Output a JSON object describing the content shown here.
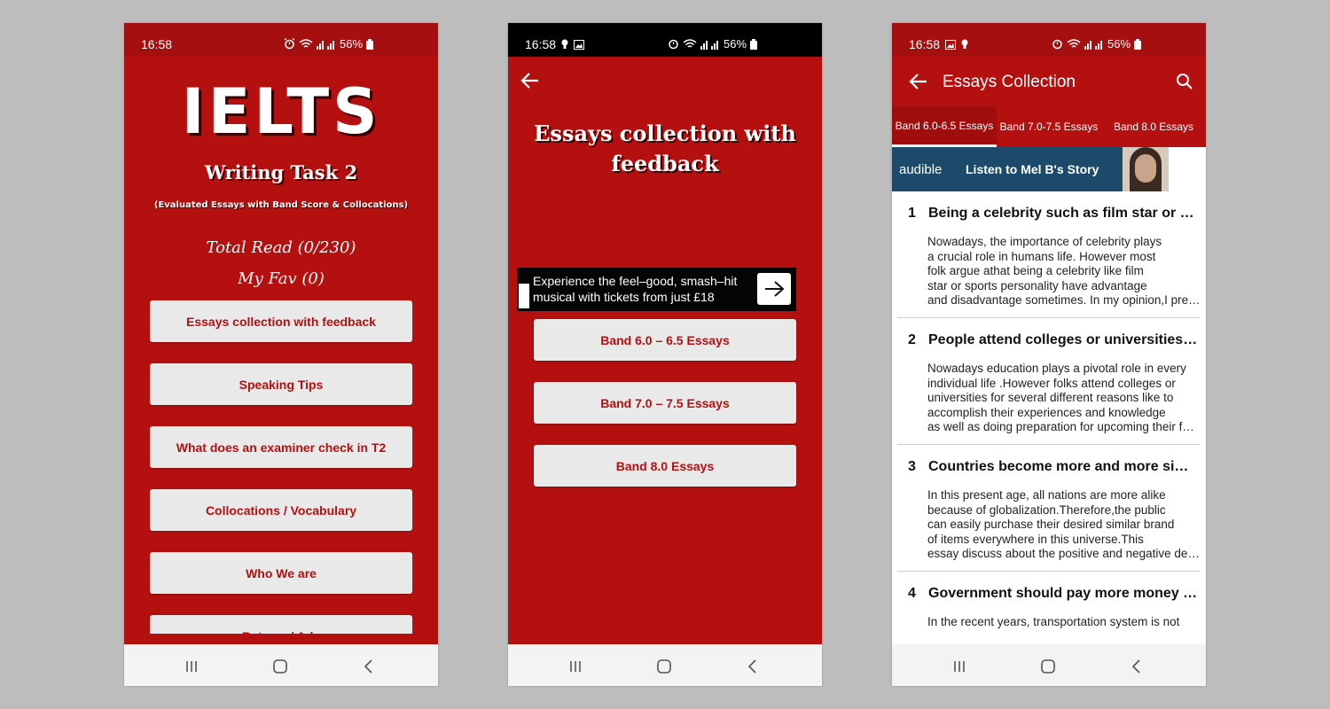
{
  "colors": {
    "primary": "#b51010",
    "button_bg": "#e9e9e9",
    "background": "#bdbdbd"
  },
  "statusbar": {
    "time": "16:58",
    "battery": "56%"
  },
  "screen1": {
    "title": "IELTS",
    "subtitle": "Writing Task 2",
    "small": "(Evaluated Essays with Band Score & Collocations)",
    "total_read": "Total Read (0/230)",
    "my_fav": "My Fav (0)",
    "menu": [
      "Essays collection with feedback",
      "Speaking Tips",
      "What does an examiner check in T2",
      "Collocations / Vocabulary",
      "Who We are",
      "Rate us / Ads"
    ]
  },
  "screen2": {
    "title": "Essays collection with feedback",
    "ad_text_line1": "Experience the feel–good, smash–hit",
    "ad_text_line2": "musical with tickets from just £18",
    "bands": [
      "Band 6.0 – 6.5 Essays",
      "Band 7.0 – 7.5 Essays",
      "Band 8.0 Essays"
    ]
  },
  "screen3": {
    "title": "Essays Collection",
    "tabs": [
      "Band 6.0-6.5 Essays",
      "Band 7.0-7.5 Essays",
      "Band 8.0 Essays"
    ],
    "ad_logo": "audible",
    "ad_headline": "Listen to Mel B's Story",
    "essays": [
      {
        "num": "1",
        "title": "Being a celebrity such as film star or sports personality",
        "excerpt": [
          "Nowadays, the importance of celebrity plays",
          "a crucial role in humans life. However most",
          "folk argue athat being a celebrity like film",
          "star or sports personality have advantage",
          "and disadvantage sometimes. In my opinion,I prefer"
        ]
      },
      {
        "num": "2",
        "title": "People attend colleges or universities for several reasons",
        "excerpt": [
          "Nowadays education plays a pivotal role in every",
          "individual life .However folks attend colleges or",
          "universities for several different reasons like to",
          "accomplish their experiences and knowledge",
          "as well as doing preparation for upcoming their future"
        ]
      },
      {
        "num": "3",
        "title": "Countries become more and more similar to each other",
        "excerpt": [
          "In this present age, all nations are more alike",
          "because of globalization.Therefore,the public",
          "can easily purchase their desired similar brand",
          "of items everywhere in this universe.This",
          "essay discuss about the positive and negative developments"
        ]
      },
      {
        "num": "4",
        "title": "Government should pay more money on public transport",
        "excerpt": [
          "In the recent years, transportation system is not"
        ]
      }
    ]
  }
}
